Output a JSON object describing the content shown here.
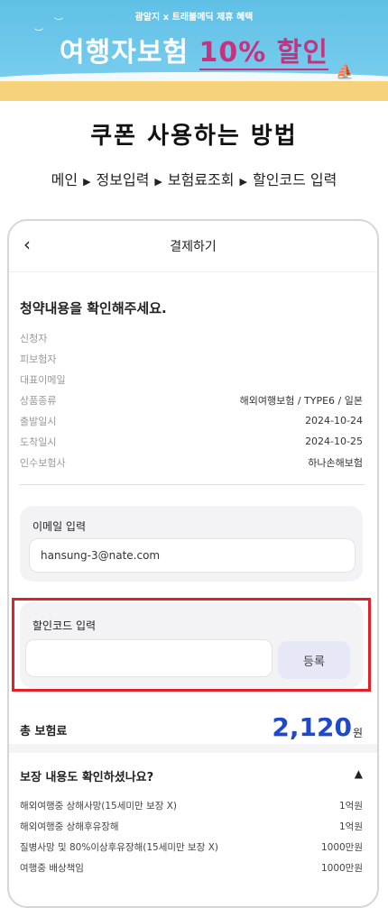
{
  "banner": {
    "subtitle": "괌알지 x 트래블메딕 제휴 혜택",
    "title_main": "여행자보험 ",
    "title_highlight": "10% 할인"
  },
  "howto_title": "쿠폰 사용하는 방법",
  "steps": [
    "메인",
    "정보입력",
    "보험료조회",
    "할인코드 입력"
  ],
  "header": {
    "title": "결제하기"
  },
  "confirm_title": "청약내용을 확인해주세요.",
  "info_rows": [
    {
      "label": "신청자",
      "value": ""
    },
    {
      "label": "피보험자",
      "value": ""
    },
    {
      "label": "대표이메일",
      "value": ""
    },
    {
      "label": "상품종류",
      "value": "해외여행보험 / TYPE6 / 일본"
    },
    {
      "label": "출발일시",
      "value": "2024-10-24"
    },
    {
      "label": "도착일시",
      "value": "2024-10-25"
    },
    {
      "label": "인수보험사",
      "value": "하나손해보험"
    }
  ],
  "email": {
    "label": "이메일 입력",
    "value": "hansung-3@nate.com"
  },
  "discount": {
    "label": "할인코드 입력",
    "value": "",
    "button": "등록"
  },
  "total": {
    "label": "총 보험료",
    "amount": "2,120",
    "unit": "원"
  },
  "coverage": {
    "title": "보장 내용도 확인하셨나요?",
    "rows": [
      {
        "label": "해외여행중 상해사망(15세미만 보장 X)",
        "value": "1억원"
      },
      {
        "label": "해외여행중 상해후유장해",
        "value": "1억원"
      },
      {
        "label": "질병사망 및 80%이상후유장해(15세미만 보장 X)",
        "value": "1000만원"
      },
      {
        "label": "여행중 배상책임",
        "value": "1000만원"
      }
    ]
  },
  "colors": {
    "accent_blue": "#1f49c8",
    "highlight_red": "#e2202a",
    "banner_sky": "#5fc0e6"
  }
}
